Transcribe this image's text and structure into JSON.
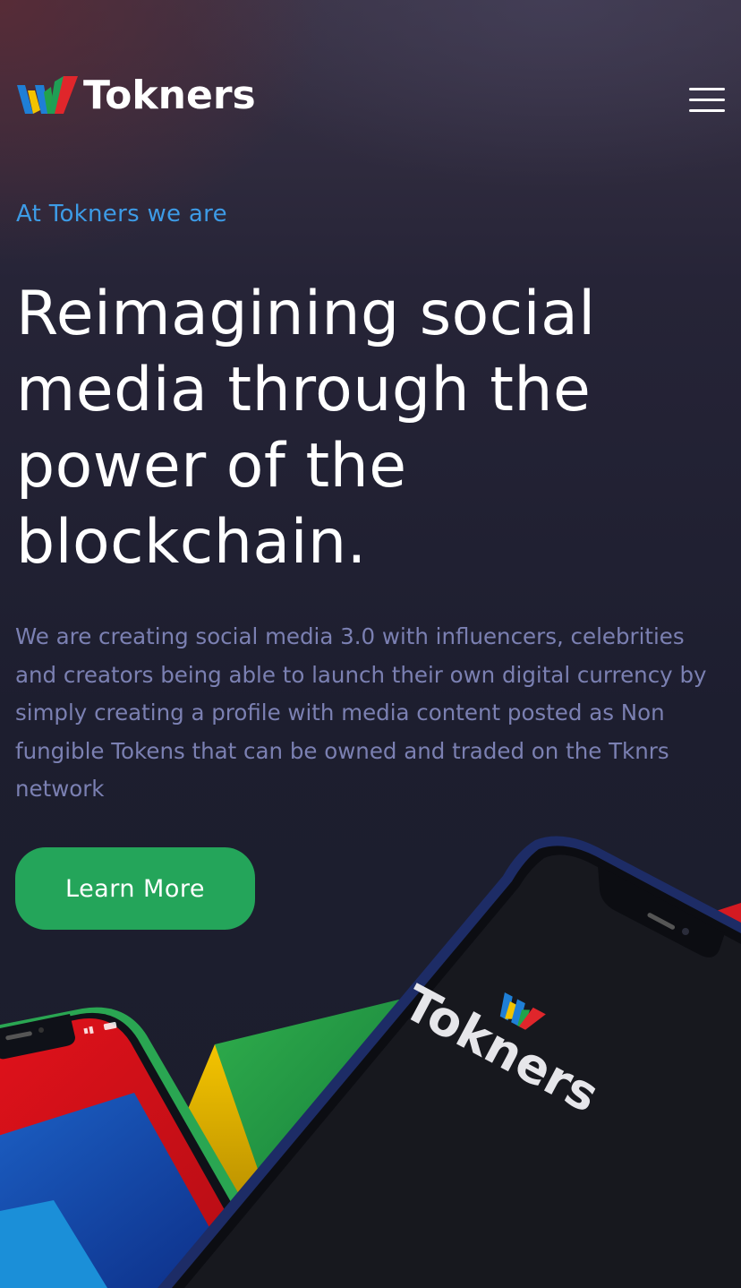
{
  "brand": {
    "name": "Tokners",
    "logo_icon": "tokners-w-logo-icon",
    "colors": {
      "blue": "#1f7fd6",
      "yellow": "#f2c300",
      "green": "#22a24b",
      "red": "#e0262b"
    }
  },
  "header": {
    "menu_icon": "hamburger-menu-icon"
  },
  "hero": {
    "eyebrow": "At Tokners we are",
    "headline": "Reimagining social media through the power of the blockchain.",
    "description": "We are creating social media 3.0 with influencers, celebrities and creators being able to launch their own digital currency by simply creating a profile with media content posted as Non fungible Tokens that can be owned and traded on the Tknrs network",
    "cta_label": "Learn More"
  },
  "illustration": {
    "phone_screen_logo_text": "Tokners"
  },
  "theme": {
    "accent_blue": "#3d9be6",
    "cta_green": "#24a55a",
    "body_text": "#7b80b2",
    "background": "#1d1e2f"
  }
}
